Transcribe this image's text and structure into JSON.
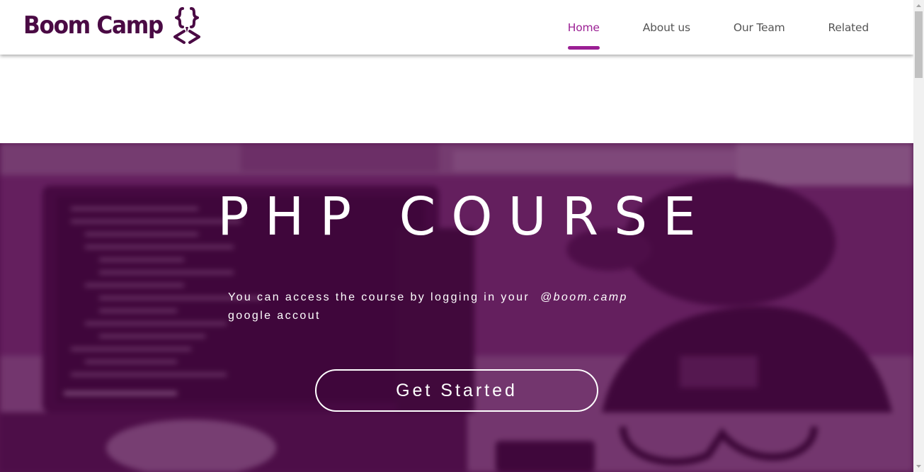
{
  "brand": {
    "name": "Boom Camp",
    "color": "#4a0a44"
  },
  "nav": {
    "items": [
      {
        "label": "Home",
        "active": true
      },
      {
        "label": "About us",
        "active": false
      },
      {
        "label": "Our Team",
        "active": false
      },
      {
        "label": "Related",
        "active": false
      }
    ],
    "active_color": "#9b1f94"
  },
  "hero": {
    "title": "PHP COURSE",
    "subtitle_before": "You can access the course by logging in your",
    "subtitle_domain": "@boom.camp",
    "subtitle_after": "google accout",
    "cta_label": "Get Started",
    "tint_color": "#5a1f54"
  }
}
